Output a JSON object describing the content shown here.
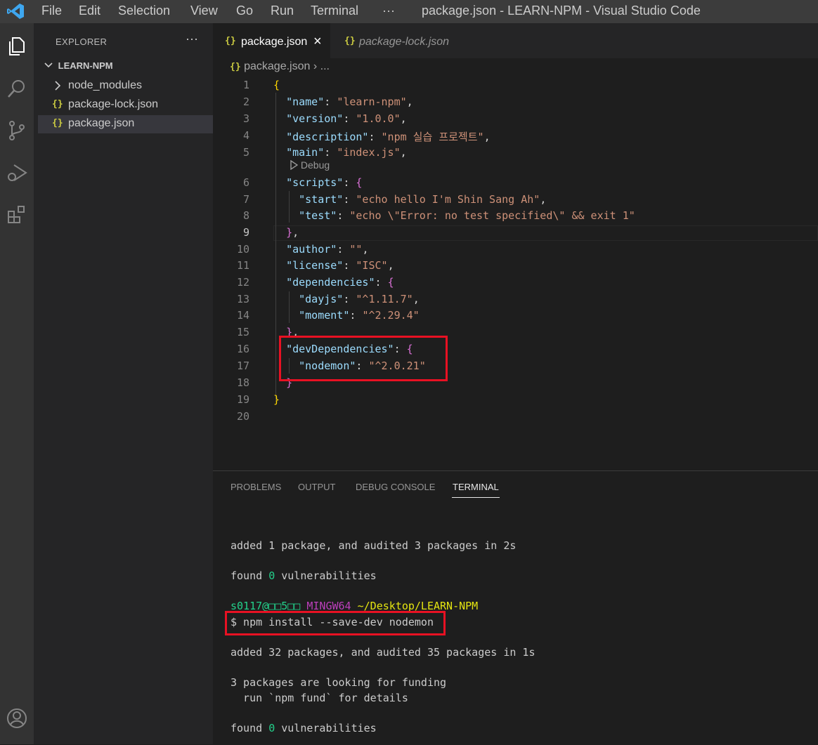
{
  "window": {
    "title": "package.json - LEARN-NPM - Visual Studio Code",
    "menu": [
      "File",
      "Edit",
      "Selection",
      "View",
      "Go",
      "Run",
      "Terminal",
      "···"
    ]
  },
  "colors": {
    "accent": "#007acc",
    "highlight_box": "#e81123",
    "json_icon": "#cbcb41"
  },
  "activity_icons": [
    "explorer-icon",
    "search-icon",
    "source-control-icon",
    "run-debug-icon",
    "extensions-icon",
    "account-icon"
  ],
  "sidebar": {
    "title": "EXPLORER",
    "more": "···",
    "project": "LEARN-NPM",
    "items": [
      {
        "label": "node_modules",
        "icon": "chevron-right-icon"
      },
      {
        "label": "package-lock.json",
        "icon": "{}"
      },
      {
        "label": "package.json",
        "icon": "{}"
      }
    ]
  },
  "tabs": [
    {
      "label": "package.json",
      "icon": "{}",
      "close": "×"
    },
    {
      "label": "package-lock.json",
      "icon": "{}"
    }
  ],
  "breadcrumb": {
    "icon": "{}",
    "file": "package.json",
    "sep": "›",
    "rest": "..."
  },
  "editor": {
    "line_numbers": [
      "1",
      "2",
      "3",
      "4",
      "5",
      "6",
      "7",
      "8",
      "9",
      "10",
      "11",
      "12",
      "13",
      "14",
      "15",
      "16",
      "17",
      "18",
      "19",
      "20"
    ],
    "codelens": "Debug",
    "code": {
      "name_key": "\"name\"",
      "name_val": "\"learn-npm\"",
      "version_key": "\"version\"",
      "version_val": "\"1.0.0\"",
      "description_key": "\"description\"",
      "description_val": "\"npm 실습 프로젝트\"",
      "main_key": "\"main\"",
      "main_val": "\"index.js\"",
      "scripts_key": "\"scripts\"",
      "start_key": "\"start\"",
      "start_val": "\"echo hello I'm Shin Sang Ah\"",
      "test_key": "\"test\"",
      "test_val": "\"echo \\\"Error: no test specified\\\" && exit 1\"",
      "author_key": "\"author\"",
      "author_val": "\"\"",
      "license_key": "\"license\"",
      "license_val": "\"ISC\"",
      "dependencies_key": "\"dependencies\"",
      "dayjs_key": "\"dayjs\"",
      "dayjs_val": "\"^1.11.7\"",
      "moment_key": "\"moment\"",
      "moment_val": "\"^2.29.4\"",
      "devdeps_key": "\"devDependencies\"",
      "nodemon_key": "\"nodemon\"",
      "nodemon_val": "\"^2.0.21\""
    }
  },
  "panel": {
    "tabs": [
      "PROBLEMS",
      "OUTPUT",
      "DEBUG CONSOLE",
      "TERMINAL"
    ],
    "terminal": {
      "l1": "added 1 package, and audited 3 packages in 2s",
      "l2a": "found ",
      "l2b": "0",
      "l2c": " vulnerabilities",
      "prompt_user": "s0117@□□5□□",
      "prompt_env": "MINGW64",
      "prompt_path": "~/Desktop/LEARN-NPM",
      "cmd": "$ npm install --save-dev nodemon",
      "l4": "added 32 packages, and audited 35 packages in 1s",
      "l5": "3 packages are looking for funding",
      "l6": "  run `npm fund` for details",
      "l7a": "found ",
      "l7b": "0",
      "l7c": " vulnerabilities"
    }
  }
}
